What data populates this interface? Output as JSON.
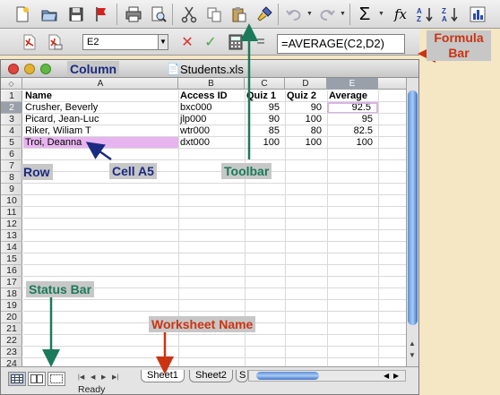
{
  "toolbar": {
    "items": [
      "new-doc",
      "open",
      "save",
      "flag",
      "print",
      "print-preview",
      "cut",
      "copy",
      "paste",
      "format-painter",
      "undo",
      "redo",
      "autosum",
      "function",
      "sort-ascending",
      "sort-descending",
      "chart-wizard"
    ],
    "sum_symbol": "Σ",
    "fx_symbol": "fx"
  },
  "formula_bar": {
    "name_box": "E2",
    "formula": "=AVERAGE(C2,D2)"
  },
  "window": {
    "title": "Students.xls"
  },
  "columns": [
    {
      "letter": "A",
      "active": false
    },
    {
      "letter": "B",
      "active": false
    },
    {
      "letter": "C",
      "active": false
    },
    {
      "letter": "D",
      "active": false
    },
    {
      "letter": "E",
      "active": true
    }
  ],
  "rows": [
    "1",
    "2",
    "3",
    "4",
    "5",
    "6",
    "7",
    "8",
    "9",
    "10",
    "11",
    "12",
    "13",
    "14",
    "15",
    "16",
    "17",
    "18",
    "19",
    "20",
    "21",
    "22",
    "23",
    "24"
  ],
  "table": {
    "headers": [
      "Name",
      "Access ID",
      "Quiz 1",
      "Quiz 2",
      "Average"
    ],
    "rows": [
      [
        "Crusher, Beverly",
        "bxc000",
        "95",
        "90",
        "92.5"
      ],
      [
        "Picard, Jean-Luc",
        "jlp000",
        "90",
        "100",
        "95"
      ],
      [
        "Riker, Wiliam T",
        "wtr000",
        "85",
        "80",
        "82.5"
      ],
      [
        "Troi, Deanna",
        "dxt000",
        "100",
        "100",
        "100"
      ]
    ]
  },
  "sheet_tabs": [
    "Sheet1",
    "Sheet2",
    "S"
  ],
  "status_text": "Ready",
  "annotations": {
    "column": "Column",
    "formula_bar": "Formula Bar",
    "formula_bar_line1": "Formula",
    "formula_bar_line2": "Bar",
    "row": "Row",
    "cell_a5": "Cell A5",
    "toolbar": "Toolbar",
    "status_bar": "Status Bar",
    "worksheet_name": "Worksheet Name"
  },
  "colors": {
    "annotation_navy": "#1a2a80",
    "annotation_green": "#1a7a5a",
    "annotation_red": "#cc3311",
    "highlight_cell": "#e8b4f0",
    "scroll_blue": "#5d8ed8"
  }
}
